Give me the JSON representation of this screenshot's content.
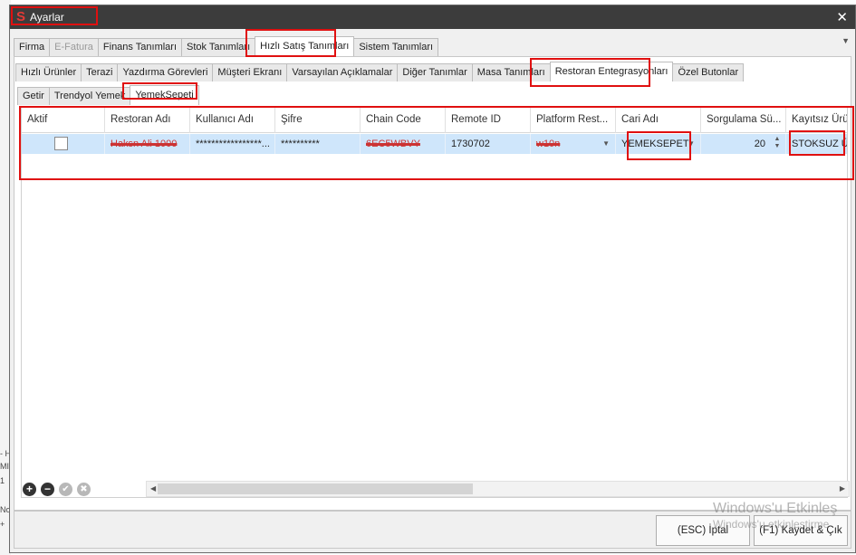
{
  "background_text": [
    "- H",
    "MI",
    "1",
    "No",
    "+"
  ],
  "window": {
    "title": "Ayarlar",
    "logo": "S",
    "close": "✕"
  },
  "tabs_main": [
    {
      "label": "Firma",
      "state": "normal"
    },
    {
      "label": "E-Fatura",
      "state": "disabled"
    },
    {
      "label": "Finans Tanımları",
      "state": "normal"
    },
    {
      "label": "Stok Tanımları",
      "state": "normal"
    },
    {
      "label": "Hızlı Satış Tanımları",
      "state": "active"
    },
    {
      "label": "Sistem Tanımları",
      "state": "normal"
    }
  ],
  "tabs_sub": [
    {
      "label": "Hızlı Ürünler",
      "state": "normal"
    },
    {
      "label": "Terazi",
      "state": "normal"
    },
    {
      "label": "Yazdırma Görevleri",
      "state": "normal"
    },
    {
      "label": "Müşteri Ekranı",
      "state": "normal"
    },
    {
      "label": "Varsayılan Açıklamalar",
      "state": "normal"
    },
    {
      "label": "Diğer Tanımlar",
      "state": "normal"
    },
    {
      "label": "Masa Tanımları",
      "state": "normal"
    },
    {
      "label": "Restoran Entegrasyonları",
      "state": "active"
    },
    {
      "label": "Özel Butonlar",
      "state": "normal"
    }
  ],
  "tabs_integration": [
    {
      "label": "Getir",
      "state": "normal"
    },
    {
      "label": "Trendyol Yemek",
      "state": "normal"
    },
    {
      "label": "YemekSepeti",
      "state": "active"
    }
  ],
  "grid": {
    "columns": [
      "Aktif",
      "Restoran Adı",
      "Kullanıcı Adı",
      "Şifre",
      "Chain Code",
      "Remote ID",
      "Platform Rest...",
      "Cari Adı",
      "Sorgulama Sü...",
      "Kayıtsız Ürü"
    ],
    "row": {
      "active": false,
      "restaurant_name": "Haksn Ali 1000",
      "username": "*****************...",
      "password": "**********",
      "chain_code": "6EC5WBVY",
      "remote_id": "1730702",
      "platform_restaurant": "w10n",
      "cari_name": "YEMEKSEPETİ",
      "query_interval": "20",
      "unregistered_product": "STOKSUZ ÜR"
    }
  },
  "toolbar": {
    "add": "+",
    "remove": "−",
    "confirm": "✔",
    "cancel": "✖"
  },
  "footer": {
    "cancel_label": "(ESC) İptal",
    "save_label": "(F1) Kaydet & Çık"
  },
  "watermark": {
    "line1": "Windows'u Etkinleş",
    "line2": "Windows'u etkinleştirme"
  },
  "annotation_color": "#e01010"
}
